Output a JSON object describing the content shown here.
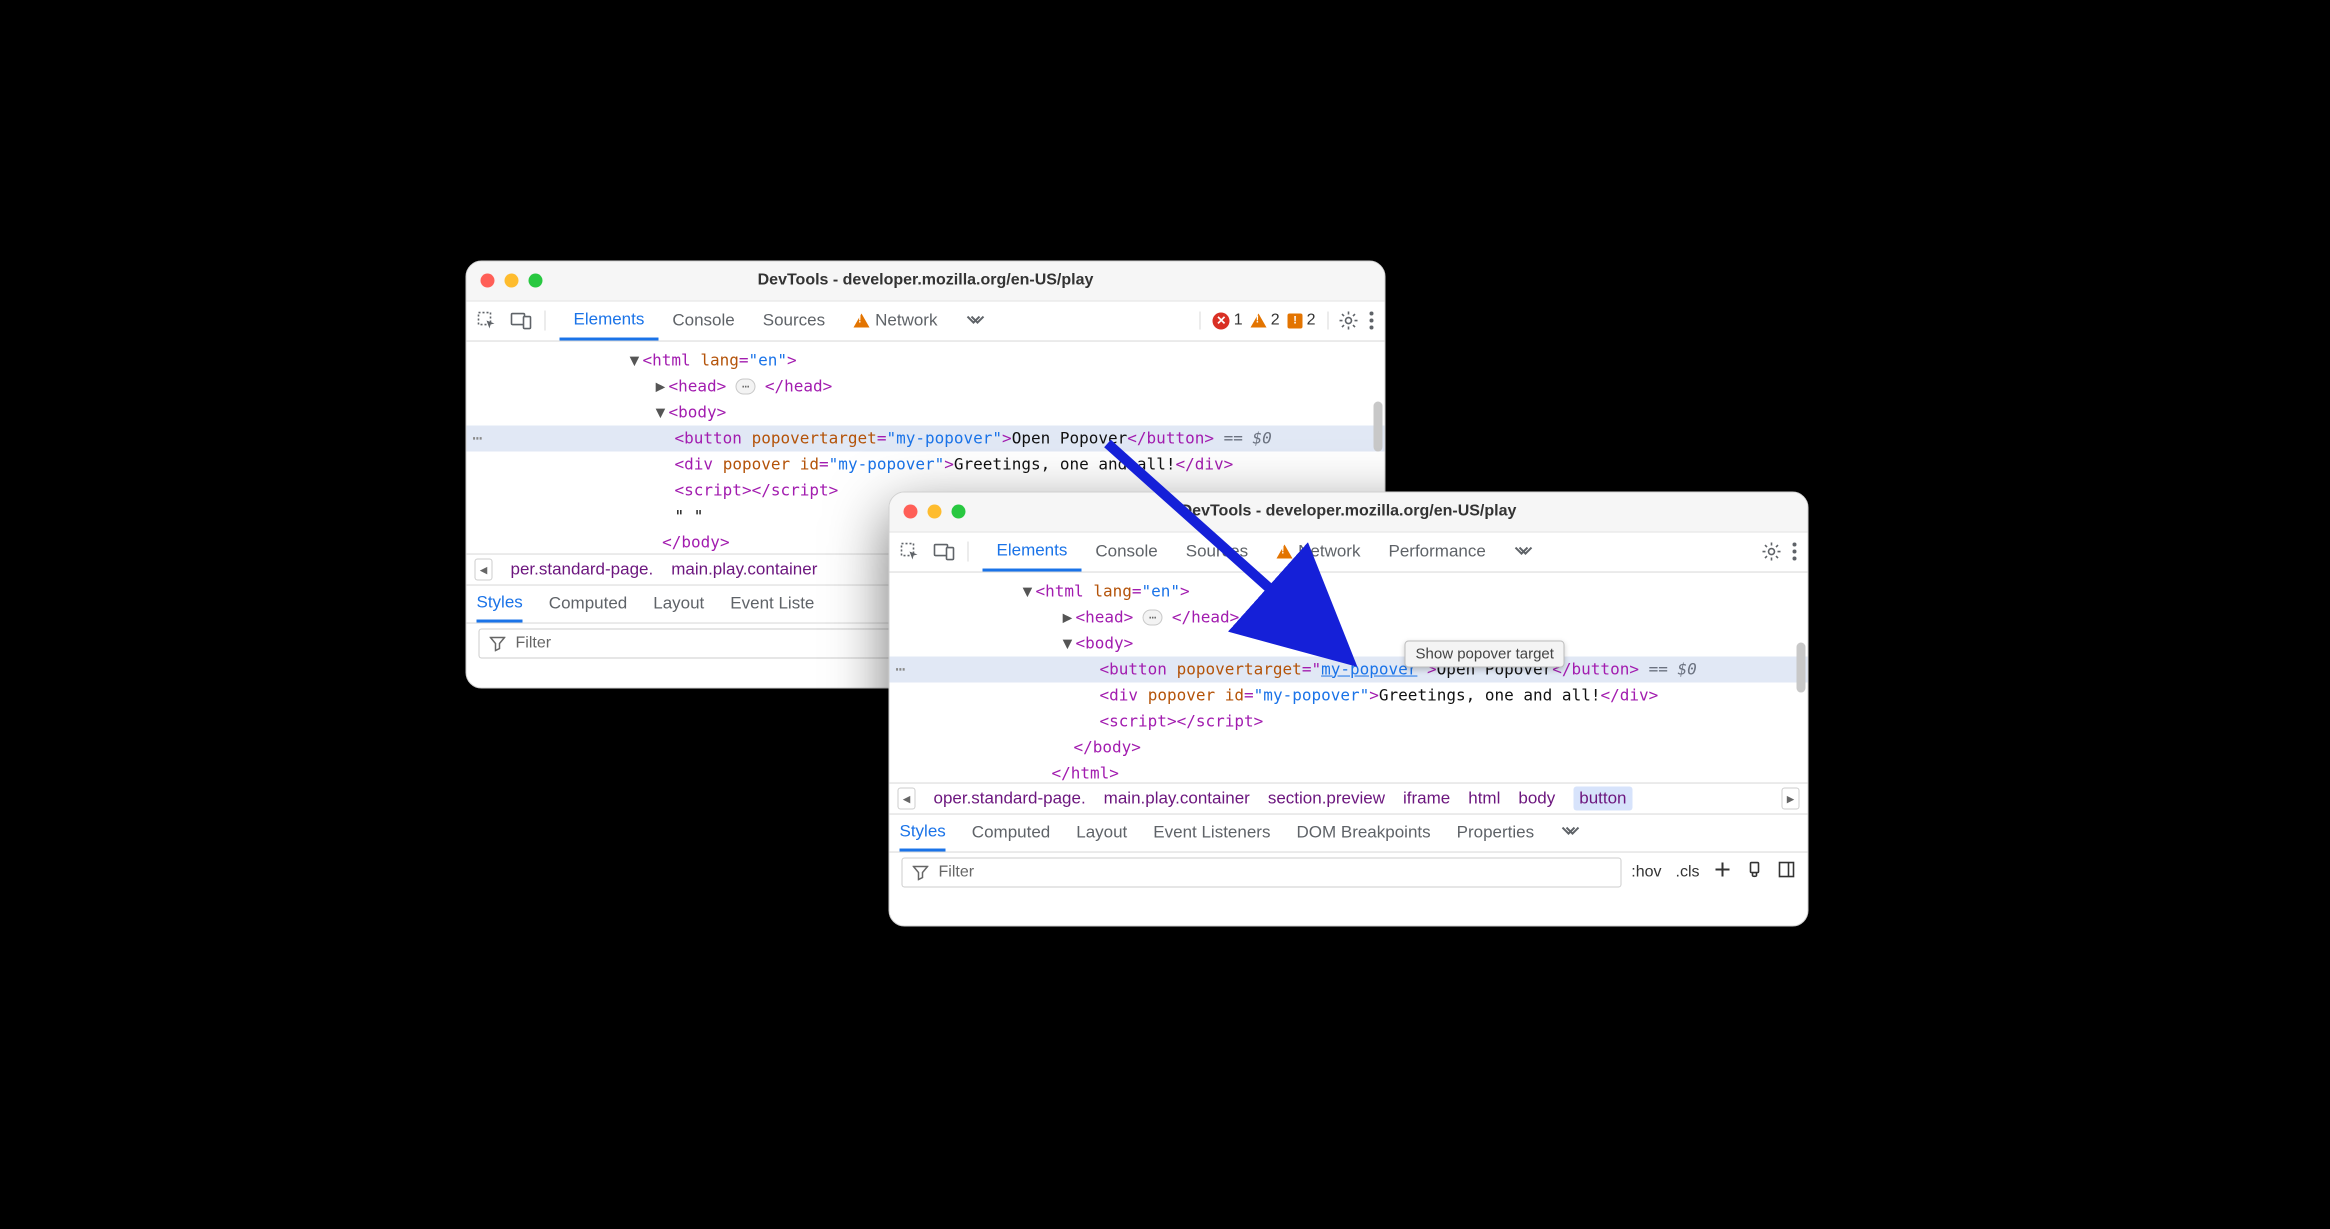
{
  "window_title": "DevTools - developer.mozilla.org/en-US/play",
  "tabs": {
    "elements": "Elements",
    "console": "Console",
    "sources": "Sources",
    "network": "Network",
    "performance": "Performance"
  },
  "counts": {
    "errors": "1",
    "warnings": "2",
    "issues": "2"
  },
  "dom": {
    "html_open": "html",
    "html_lang_attr": "lang",
    "html_lang_val": "\"en\"",
    "head": "head",
    "body": "body",
    "button": "button",
    "button_attr": "popovertarget",
    "button_val": "\"my-popover\"",
    "button_val_link": "my-popover",
    "button_text": "Open Popover",
    "div": "div",
    "div_attr1": "popover",
    "div_attr2": "id",
    "div_val": "\"my-popover\"",
    "div_text": "Greetings, one and all!",
    "script": "script",
    "empty_text": "\" \"",
    "sel_marker": " == ",
    "sel_var": "$0",
    "html_close": "html"
  },
  "crumbs": {
    "c1": "per.standard-page.",
    "c1b": "oper.standard-page.",
    "c2": "main.play.container",
    "c3": "section.preview",
    "c4": "iframe",
    "c5": "html",
    "c6": "body",
    "c7": "button"
  },
  "panel_tabs": {
    "styles": "Styles",
    "computed": "Computed",
    "layout": "Layout",
    "event": "Event Listeners",
    "event_short": "Event Liste",
    "dom_bp": "DOM Breakpoints",
    "properties": "Properties"
  },
  "filter_placeholder": "Filter",
  "hov": ":hov",
  "cls": ".cls",
  "tooltip": "Show popover target"
}
